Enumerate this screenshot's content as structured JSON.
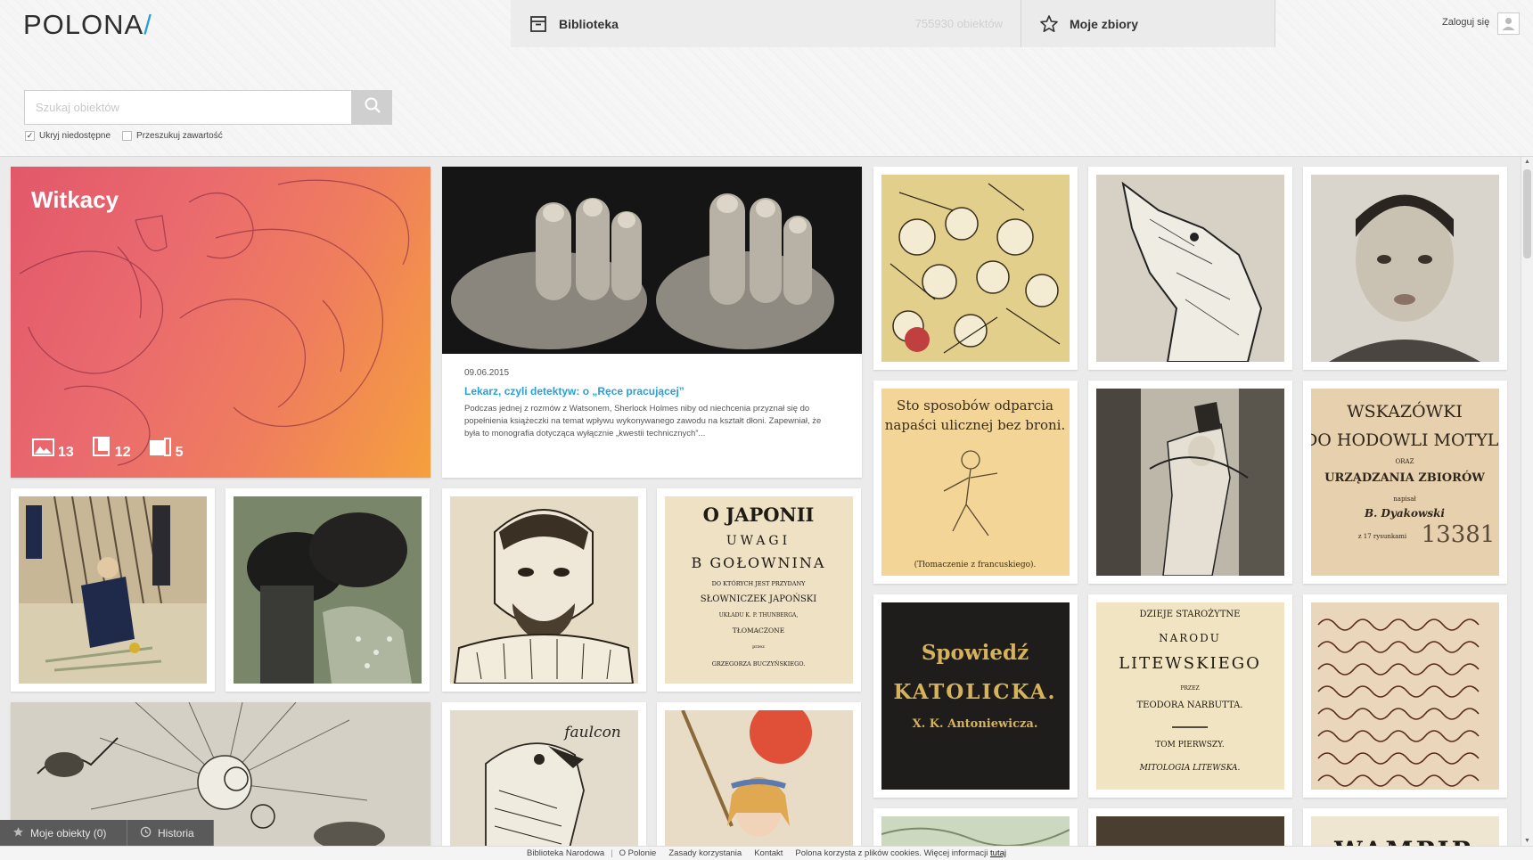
{
  "header": {
    "logo": "POLONA",
    "logo_slash": "/",
    "nav": [
      {
        "label": "Biblioteka",
        "count": "755930 obiektów"
      },
      {
        "label": "Moje zbiory"
      }
    ],
    "login_label": "Zaloguj się"
  },
  "search": {
    "placeholder": "Szukaj obiektów",
    "value": "",
    "options": [
      {
        "label": "Ukryj niedostępne",
        "checked": true
      },
      {
        "label": "Przeszukuj zawartość",
        "checked": false
      }
    ]
  },
  "collection_card": {
    "title": "Witkacy",
    "stats": {
      "images": "13",
      "books": "12",
      "documents": "5"
    }
  },
  "article_card": {
    "date": "09.06.2015",
    "title": "Lekarz, czyli detektyw: o „Ręce pracującej”",
    "excerpt": "Podczas jednej z rozmów z Watsonem, Sherlock Holmes niby od niechcenia przyznał się do popełnienia książeczki na temat wpływu wykonywanego zawodu na kształt dłoni. Zapewniał, że była to monografia dotycząca wyłącznie „kwestii technicznych”..."
  },
  "thumb_texts": {
    "sto": {
      "line1": "Sto sposobów odparcia",
      "line2": "napaści ulicznej bez broni.",
      "note": "(Tłomaczenie z francuskiego)."
    },
    "wskazowki": {
      "line1": "WSKAZÓWKI",
      "line2": "DO HODOWLI MOTYLI",
      "line3": "ORAZ",
      "line4": "URZĄDZANIA ZBIORÓW",
      "line5": "napisał",
      "author": "B. Dyakowski",
      "note": "z 17 rysunkami",
      "stamp": "13381"
    },
    "japonii": {
      "line1": "O JAPONII",
      "line2": "UWAGI",
      "line3": "B GOŁOWNINA",
      "line4": "DO KTÓRYCH JEST PRZYDANY",
      "line5": "SŁOWNICZEK JAPOŃSKI",
      "line6": "UKŁADU K. P. THUNBERGA,",
      "line7": "TŁOMACZONE",
      "line8": "przez",
      "line9": "GRZEGORZA BUCZYŃSKIEGO."
    },
    "spowiedz": {
      "line1": "Spowiedź",
      "line2": "KATOLICKA.",
      "line3": "X. K. Antoniewicza."
    },
    "dzieje": {
      "line1": "DZIEJE STAROŻYTNE",
      "line2": "NARODU",
      "line3": "LITEWSKIEGO",
      "line4": "PRZEZ",
      "line5": "TEODORA NARBUTTA.",
      "line6": "TOM PIERWSZY.",
      "line7": "MITOLOGIA LITEWSKA."
    },
    "faulcon": {
      "line1": "faulcon"
    },
    "wampir": {
      "line1": "WAMPIR"
    }
  },
  "bottom_tabs": [
    {
      "label": "Moje obiekty (0)"
    },
    {
      "label": "Historia"
    }
  ],
  "footer": {
    "links": [
      "Biblioteka Narodowa",
      "O Polonie",
      "Zasady korzystania",
      "Kontakt"
    ],
    "cookies_text": "Polona korzysta z plików cookies. Więcej informacji",
    "cookies_link": "tutaj"
  },
  "colors": {
    "accent": "#2a9fd6",
    "collection_gradient_start": "#e2586a",
    "collection_gradient_end": "#f5a03d",
    "bottom_bar": "#5a5a5a"
  },
  "icons": [
    "library-icon",
    "star-icon",
    "search-icon",
    "user-icon",
    "image-icon",
    "book-icon",
    "documents-icon",
    "history-icon",
    "checkmark-icon"
  ]
}
